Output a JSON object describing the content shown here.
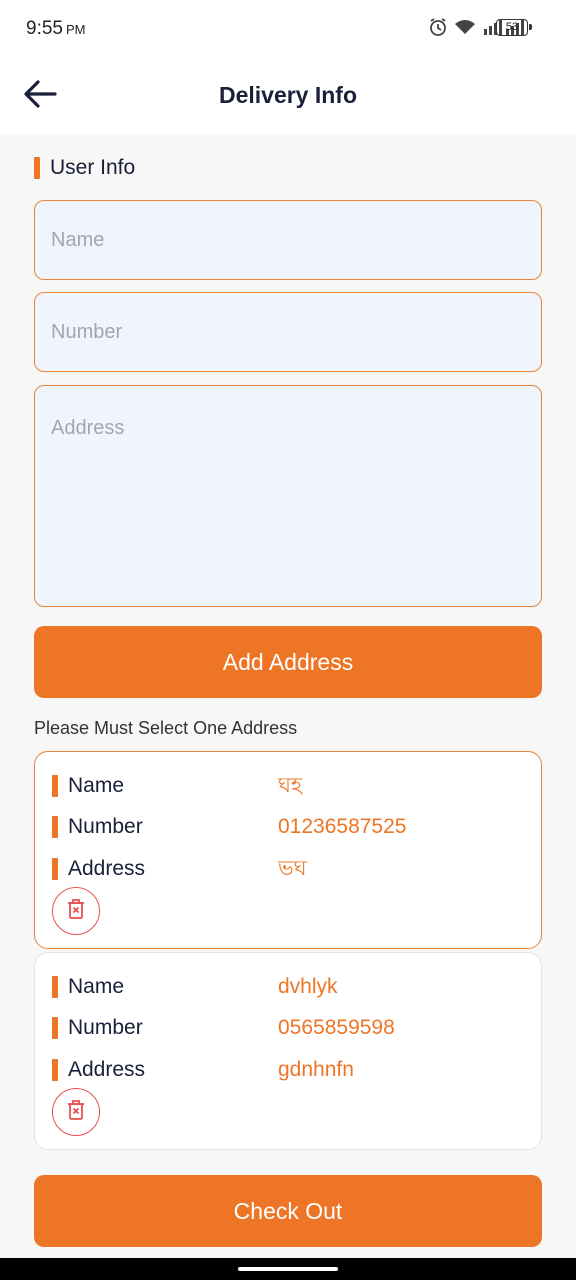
{
  "status": {
    "time": "9:55",
    "ampm": "PM",
    "battery": "53"
  },
  "header": {
    "title": "Delivery Info"
  },
  "user_info": {
    "section_title": "User Info",
    "name_placeholder": "Name",
    "number_placeholder": "Number",
    "address_placeholder": "Address"
  },
  "actions": {
    "add_address": "Add Address",
    "checkout": "Check Out"
  },
  "notice": "Please Must Select One Address",
  "labels": {
    "name": "Name",
    "number": "Number",
    "address": "Address"
  },
  "addresses": [
    {
      "name": "ঘহ",
      "number": "01236587525",
      "address": "ভঘ",
      "selected": true
    },
    {
      "name": "dvhlyk",
      "number": "0565859598",
      "address": "gdnhnfn",
      "selected": false
    }
  ],
  "colors": {
    "accent": "#ee7526",
    "title": "#1a1f3a",
    "delete": "#e94f4f",
    "field_bg": "#f0f4fc"
  },
  "icons": {
    "back": "arrow-left-icon",
    "delete": "trash-icon",
    "alarm": "alarm-icon",
    "wifi": "wifi-icon",
    "signal": "signal-icon"
  }
}
